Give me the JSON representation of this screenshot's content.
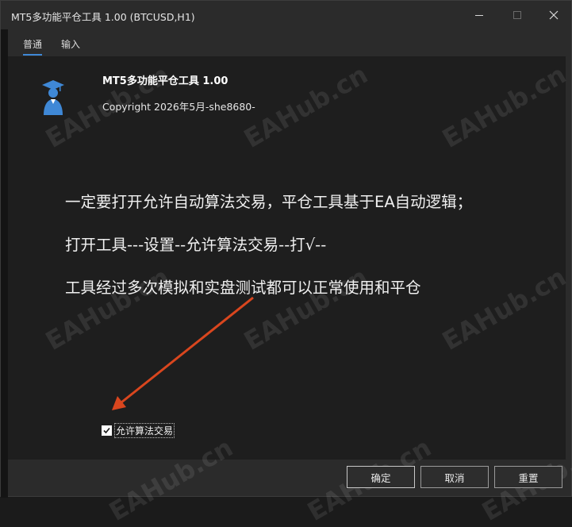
{
  "window": {
    "title": "MT5多功能平仓工具 1.00 (BTCUSD,H1)"
  },
  "tabs": [
    {
      "label": "普通",
      "active": true
    },
    {
      "label": "输入",
      "active": false
    }
  ],
  "app": {
    "name": "MT5多功能平仓工具 1.00",
    "copyright": "Copyright 2026年5月-she8680-"
  },
  "instructions": [
    "一定要打开允许自动算法交易，平仓工具基于EA自动逻辑；",
    "打开工具---设置--允许算法交易--打√--",
    "工具经过多次模拟和实盘测试都可以正常使用和平仓"
  ],
  "checkbox": {
    "label": "允许算法交易",
    "checked": true
  },
  "buttons": {
    "ok": "确定",
    "cancel": "取消",
    "reset": "重置"
  },
  "watermark": "EAHub.cn",
  "colors": {
    "accent": "#3f88d6",
    "arrow": "#d9461e",
    "logo": "#3f88d6"
  },
  "icons": {
    "logo": "graduate-cap-icon",
    "minimize": "minimize-icon",
    "maximize": "maximize-icon",
    "close": "close-icon",
    "checkmark": "checkmark-icon"
  }
}
